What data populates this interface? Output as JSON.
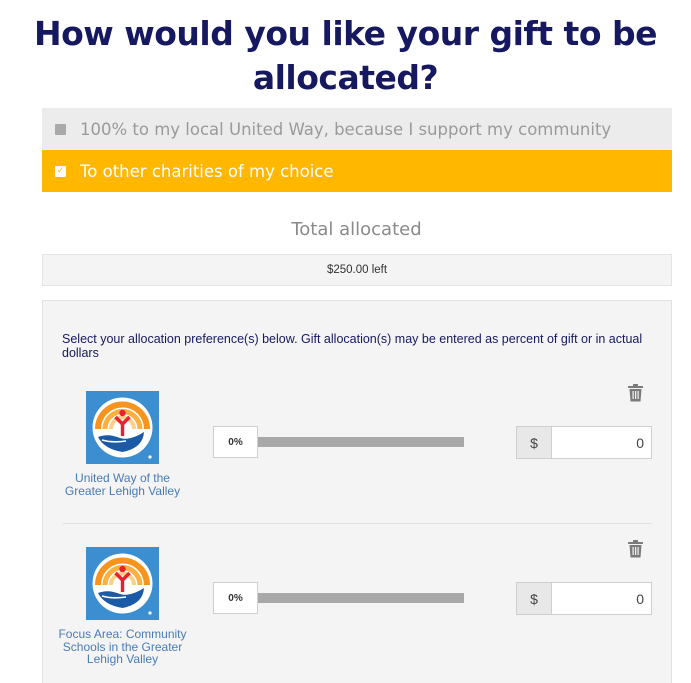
{
  "heading": {
    "line1": "How would you like your gift to be",
    "line2": "allocated?"
  },
  "options": [
    {
      "label": "100% to my local United Way, because I support my community",
      "checked": false
    },
    {
      "label": "To other charities of my choice",
      "checked": true
    }
  ],
  "total": {
    "label": "Total allocated",
    "remaining": "$250.00 left"
  },
  "instructions": "Select your allocation preference(s) below. Gift allocation(s) may be entered as percent of gift or in actual dollars",
  "allocations": [
    {
      "org_name": "United Way of the Greater Lehigh Valley",
      "percent": "0%",
      "currency_symbol": "$",
      "amount": "0",
      "slider_value": 0
    },
    {
      "org_name": "Focus Area: Community Schools in the Greater Lehigh Valley",
      "percent": "0%",
      "currency_symbol": "$",
      "amount": "0",
      "slider_value": 0
    }
  ],
  "colors": {
    "heading": "#16195f",
    "selected_option_bg": "#ffb700",
    "unselected_option_bg": "#ececec",
    "logo_bg": "#3b8ed0",
    "org_link": "#4a7bb5"
  },
  "icons": {
    "trash": "trash-icon",
    "checkbox": "checkbox-icon",
    "logo": "united-way-logo"
  }
}
